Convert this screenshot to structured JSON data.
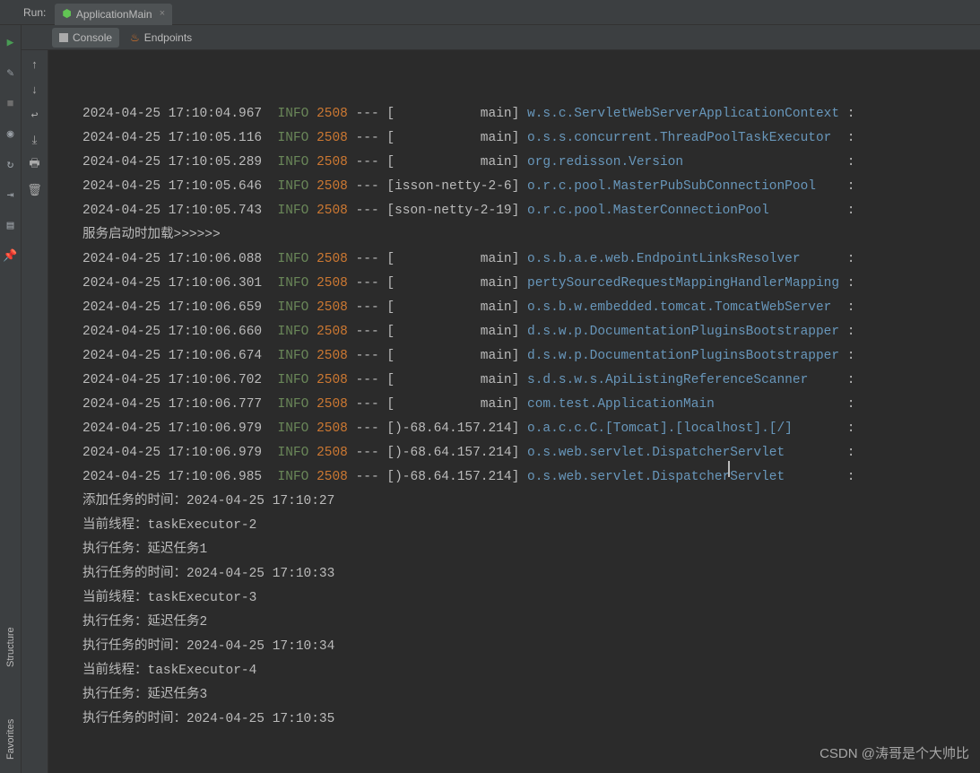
{
  "header": {
    "run_label": "Run:",
    "tab_name": "ApplicationMain"
  },
  "tool_tabs": {
    "console": "Console",
    "endpoints": "Endpoints"
  },
  "sidebar_labels": {
    "structure": "Structure",
    "favorites": "Favorites"
  },
  "colors": {
    "info": "#6a8759",
    "pid": "#cc7832",
    "source": "#6897bb",
    "text": "#bbbbbb",
    "bg": "#2b2b2b"
  },
  "log_lines": [
    {
      "type": "log",
      "ts": "2024-04-25 17:10:04.967",
      "level": "INFO",
      "pid": "2508",
      "thread": "[           main]",
      "src": "w.s.c.ServletWebServerApplicationContext"
    },
    {
      "type": "log",
      "ts": "2024-04-25 17:10:05.116",
      "level": "INFO",
      "pid": "2508",
      "thread": "[           main]",
      "src": "o.s.s.concurrent.ThreadPoolTaskExecutor "
    },
    {
      "type": "log",
      "ts": "2024-04-25 17:10:05.289",
      "level": "INFO",
      "pid": "2508",
      "thread": "[           main]",
      "src": "org.redisson.Version                    "
    },
    {
      "type": "log",
      "ts": "2024-04-25 17:10:05.646",
      "level": "INFO",
      "pid": "2508",
      "thread": "[isson-netty-2-6]",
      "src": "o.r.c.pool.MasterPubSubConnectionPool   "
    },
    {
      "type": "log",
      "ts": "2024-04-25 17:10:05.743",
      "level": "INFO",
      "pid": "2508",
      "thread": "[sson-netty-2-19]",
      "src": "o.r.c.pool.MasterConnectionPool         "
    },
    {
      "type": "plain",
      "text": "服务启动时加载>>>>>>"
    },
    {
      "type": "log",
      "ts": "2024-04-25 17:10:06.088",
      "level": "INFO",
      "pid": "2508",
      "thread": "[           main]",
      "src": "o.s.b.a.e.web.EndpointLinksResolver     "
    },
    {
      "type": "log",
      "ts": "2024-04-25 17:10:06.301",
      "level": "INFO",
      "pid": "2508",
      "thread": "[           main]",
      "src": "pertySourcedRequestMappingHandlerMapping"
    },
    {
      "type": "log",
      "ts": "2024-04-25 17:10:06.659",
      "level": "INFO",
      "pid": "2508",
      "thread": "[           main]",
      "src": "o.s.b.w.embedded.tomcat.TomcatWebServer "
    },
    {
      "type": "log",
      "ts": "2024-04-25 17:10:06.660",
      "level": "INFO",
      "pid": "2508",
      "thread": "[           main]",
      "src": "d.s.w.p.DocumentationPluginsBootstrapper"
    },
    {
      "type": "log",
      "ts": "2024-04-25 17:10:06.674",
      "level": "INFO",
      "pid": "2508",
      "thread": "[           main]",
      "src": "d.s.w.p.DocumentationPluginsBootstrapper"
    },
    {
      "type": "log",
      "ts": "2024-04-25 17:10:06.702",
      "level": "INFO",
      "pid": "2508",
      "thread": "[           main]",
      "src": "s.d.s.w.s.ApiListingReferenceScanner    "
    },
    {
      "type": "log",
      "ts": "2024-04-25 17:10:06.777",
      "level": "INFO",
      "pid": "2508",
      "thread": "[           main]",
      "src": "com.test.ApplicationMain                "
    },
    {
      "type": "log",
      "ts": "2024-04-25 17:10:06.979",
      "level": "INFO",
      "pid": "2508",
      "thread": "[)-68.64.157.214]",
      "src": "o.a.c.c.C.[Tomcat].[localhost].[/]      "
    },
    {
      "type": "log",
      "ts": "2024-04-25 17:10:06.979",
      "level": "INFO",
      "pid": "2508",
      "thread": "[)-68.64.157.214]",
      "src": "o.s.web.servlet.DispatcherServlet       "
    },
    {
      "type": "log",
      "ts": "2024-04-25 17:10:06.985",
      "level": "INFO",
      "pid": "2508",
      "thread": "[)-68.64.157.214]",
      "src": "o.s.web.servlet.DispatcherServlet       "
    },
    {
      "type": "plain",
      "text": "添加任务的时间：2024-04-25 17:10:27"
    },
    {
      "type": "plain",
      "text": ""
    },
    {
      "type": "plain",
      "text": "当前线程：taskExecutor-2"
    },
    {
      "type": "plain",
      "text": "执行任务：延迟任务1"
    },
    {
      "type": "plain",
      "text": "执行任务的时间：2024-04-25 17:10:33"
    },
    {
      "type": "plain",
      "text": ""
    },
    {
      "type": "plain",
      "text": "当前线程：taskExecutor-3"
    },
    {
      "type": "plain",
      "text": "执行任务：延迟任务2"
    },
    {
      "type": "plain",
      "text": "执行任务的时间：2024-04-25 17:10:34"
    },
    {
      "type": "plain",
      "text": ""
    },
    {
      "type": "plain",
      "text": "当前线程：taskExecutor-4"
    },
    {
      "type": "plain",
      "text": "执行任务：延迟任务3"
    },
    {
      "type": "plain",
      "text": "执行任务的时间：2024-04-25 17:10:35"
    }
  ],
  "watermark": "CSDN @涛哥是个大帅比"
}
